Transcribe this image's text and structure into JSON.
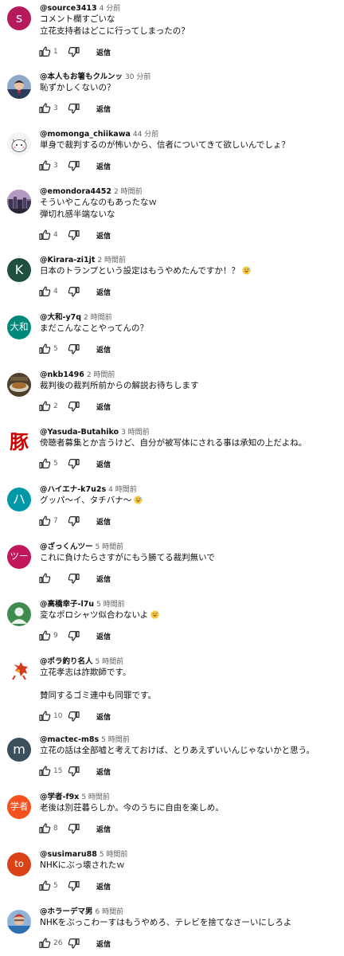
{
  "reply_label": "返信",
  "comments": [
    {
      "author": "@source3413",
      "time": "4 分前",
      "lines": [
        "コメント欄すごいな",
        "立花支持者はどこに行ってしまったの？"
      ],
      "likes": "1",
      "avatar": {
        "kind": "letter",
        "text": "s",
        "color": "#b5195b"
      }
    },
    {
      "author": "@本人もお箸もクルンッ",
      "time": "30 分前",
      "lines": [
        "恥ずかしくないの？"
      ],
      "likes": "3",
      "avatar": {
        "kind": "photo-person",
        "text": "",
        "color": "#3a4d6b"
      }
    },
    {
      "author": "@momonga_chiikawa",
      "time": "44 分前",
      "lines": [
        "単身で裁判するのが怖いから、信者についてきて欲しいんでしょ？"
      ],
      "likes": "3",
      "avatar": {
        "kind": "drawing",
        "text": "",
        "color": "#f4f4f4"
      }
    },
    {
      "author": "@emondora4452",
      "time": "2 時間前",
      "lines": [
        "そういやこんなのもあったなｗ",
        "弾切れ感半端ないな"
      ],
      "likes": "4",
      "avatar": {
        "kind": "photo-city",
        "text": "",
        "color": "#6b5a7a"
      }
    },
    {
      "author": "@Kirara-zi1jt",
      "time": "2 時間前",
      "lines": [
        "日本のトランプという設定はもうやめたんですか！？"
      ],
      "emoji_after_line": 0,
      "likes": "4",
      "avatar": {
        "kind": "letter",
        "text": "K",
        "color": "#1f4f3f"
      }
    },
    {
      "author": "@大和-y7q",
      "time": "2 時間前",
      "lines": [
        "まだこんなことやってんの？"
      ],
      "likes": "5",
      "avatar": {
        "kind": "letter",
        "text": "大和",
        "color": "#00897b"
      }
    },
    {
      "author": "@nkb1496",
      "time": "2 時間前",
      "lines": [
        "裁判後の裁判所前からの解説お待ちします"
      ],
      "likes": "2",
      "avatar": {
        "kind": "photo-food",
        "text": "",
        "color": "#5d4a32"
      }
    },
    {
      "author": "@Yasuda-Butahiko",
      "time": "3 時間前",
      "lines": [
        "傍聴者募集とか言うけど、自分が被写体にされる事は承知の上だよね。"
      ],
      "likes": "5",
      "avatar": {
        "kind": "kanji",
        "text": "豚",
        "color": "#cc0000"
      }
    },
    {
      "author": "@ハイエナ-k7u2s",
      "time": "4 時間前",
      "lines": [
        "グッパ～イ、タチバナ～"
      ],
      "emoji_after_line": 0,
      "likes": "7",
      "avatar": {
        "kind": "letter",
        "text": "ハ",
        "color": "#0097a7"
      }
    },
    {
      "author": "@ざっくんツー",
      "time": "5 時間前",
      "lines": [
        "これに負けたらさすがにもう勝てる裁判無いで"
      ],
      "likes": "",
      "avatar": {
        "kind": "letter",
        "text": "ツー",
        "color": "#c2185b"
      }
    },
    {
      "author": "@高橋幸子-l7u",
      "time": "5 時間前",
      "lines": [
        "変なポロシャツ似合わないよ"
      ],
      "emoji_after_line": 0,
      "likes": "9",
      "avatar": {
        "kind": "default-user",
        "text": "",
        "color": "#3f8a4f"
      }
    },
    {
      "author": "@ポラ釣り名人",
      "time": "5 時間前",
      "lines": [
        "立花孝志は詐欺師です。",
        "",
        "賛同するゴミ連中も同罪です。"
      ],
      "likes": "10",
      "avatar": {
        "kind": "drawing-red",
        "text": "",
        "color": "#ffffff"
      }
    },
    {
      "author": "@mactec-m8s",
      "time": "5 時間前",
      "lines": [
        "立花の話は全部嘘と考えておけば、とりあえずいいんじゃないかと思う。"
      ],
      "likes": "15",
      "avatar": {
        "kind": "letter",
        "text": "m",
        "color": "#3c4f5c"
      }
    },
    {
      "author": "@学者-f9x",
      "time": "5 時間前",
      "lines": [
        "老後は別荘暮らしか。今のうちに自由を楽しめ。"
      ],
      "likes": "8",
      "avatar": {
        "kind": "letter",
        "text": "学者",
        "color": "#f4511e"
      }
    },
    {
      "author": "@susimaru88",
      "time": "5 時間前",
      "lines": [
        "NHKにぶっ壊されたｗ"
      ],
      "likes": "5",
      "avatar": {
        "kind": "letter",
        "text": "to",
        "color": "#d84315"
      }
    },
    {
      "author": "@ホラーデマ男",
      "time": "6 時間前",
      "lines": [
        "NHKをぶっこわーすはもうやめろ、テレビを捨てなさーいにしろよ"
      ],
      "likes": "26",
      "avatar": {
        "kind": "photo-man",
        "text": "",
        "color": "#8fb3d9"
      }
    }
  ]
}
